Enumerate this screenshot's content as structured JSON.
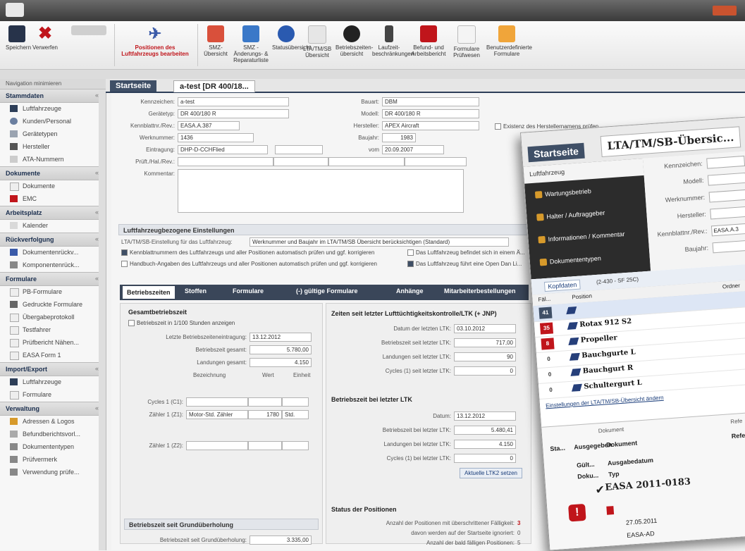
{
  "ribbon": {
    "buttons": [
      {
        "label": "Speichern"
      },
      {
        "label": "Verwerfen"
      },
      {
        "label": "Positionen des Luftfahrzeugs bearbeiten"
      },
      {
        "label": "SMZ-Übersicht"
      },
      {
        "label": "SMZ - Änderungs- & Reparaturliste"
      },
      {
        "label": "Statusübersicht"
      },
      {
        "label": "LTA/TM/SB Übersicht"
      },
      {
        "label": "Betriebszeiten-übersicht"
      },
      {
        "label": "Laufzeit-beschränkungen"
      },
      {
        "label": "Befund- und Arbeitsbericht"
      },
      {
        "label": "Formulare Prüfwesen"
      },
      {
        "label": "Benutzerdefinierte Formulare"
      }
    ]
  },
  "sidebar": {
    "topbar": "Navigation minimieren",
    "groups": [
      {
        "title": "Stammdaten",
        "items": [
          "Luftfahrzeuge",
          "Kunden/Personal",
          "Gerätetypen",
          "Hersteller",
          "ATA-Nummern"
        ]
      },
      {
        "title": "Dokumente",
        "items": [
          "Dokumente",
          "EMC"
        ]
      },
      {
        "title": "Arbeitsplatz",
        "items": [
          "Kalender"
        ]
      },
      {
        "title": "Rückverfolgung",
        "items": [
          "Dokumentenrückv...",
          "Komponentenrück..."
        ]
      },
      {
        "title": "Formulare",
        "items": [
          "PB-Formulare",
          "Gedruckte Formulare",
          "Übergabeprotokoll",
          "Testfahrer",
          "Prüfbericht Nähen...",
          "EASA Form 1"
        ]
      },
      {
        "title": "Import/Export",
        "items": [
          "Luftfahrzeuge",
          "Formulare"
        ]
      },
      {
        "title": "Verwaltung",
        "items": [
          "Adressen & Logos",
          "Befundberichtsvorl...",
          "Dokumententypen",
          "Prüfvermerk",
          "Verwendung prüfe..."
        ]
      }
    ]
  },
  "tabs": {
    "start": "Startseite",
    "current": "a-test [DR 400/18..."
  },
  "form": {
    "kennzeichen_label": "Kennzeichen:",
    "kennzeichen": "a-test",
    "geraetetyp_label": "Gerätetyp:",
    "geraetetyp": "DR 400/180 R",
    "kennblatt_label": "Kennblattnr./Rev.:",
    "kennblatt": "EASA.A.387",
    "werknummer_label": "Werknummer:",
    "werknummer": "1436",
    "eintragung_label": "Eintragung:",
    "eintragung": "DHP-D-CCHFlied",
    "prueft_label": "Prüft./Hal./Rev.:",
    "kommentar_label": "Kommentar:",
    "bauart_label": "Bauart:",
    "bauart": "DBM",
    "modell_label": "Modell:",
    "modell": "DR 400/180 R",
    "hersteller_label": "Hersteller:",
    "hersteller": "APEX Aircraft",
    "baujahr_label": "Baujahr:",
    "baujahr": "1983",
    "vom_label": "vom",
    "vom": "20.09.2007",
    "check_hersteller": "Existenz des Herstellernamens prüfen",
    "settings_title": "Luftfahrzeugbezogene Einstellungen",
    "settings_line": "LTA/TM/SB-Einstellung für das Luftfahrzeug:",
    "settings_value": "Werknummer und Baujahr im LTA/TM/SB Übersicht berücksichtigen (Standard)",
    "chk1": "Kennblattnummern des Luftfahrzeugs und aller Positionen automatisch prüfen und ggf. korrigieren",
    "chk2": "Handbuch-Angaben des Luftfahrzeugs und aller Positionen automatisch prüfen und ggf. korrigieren",
    "chk3": "Das Luftfahrzeug befindet sich in einem Ä...",
    "chk4": "Das Luftfahrzeug führt eine Open Dan Li..."
  },
  "subtabs": [
    "Betriebszeiten",
    "Stoffen",
    "Formulare",
    "(-) gültige Formulare",
    "Anhänge",
    "Mitarbeiterbestellungen"
  ],
  "betrieb": {
    "title": "Gesamtbetriebszeit",
    "chk": "Betriebszeit in 1/100 Stunden anzeigen",
    "l1": "Letzte Betriebszeiteneintragung:",
    "v1": "13.12.2012",
    "l2": "Betriebszeit gesamt:",
    "v2": "5.780,00",
    "l3": "Landungen gesamt:",
    "v3": "4.150",
    "c1": "Bezeichnung",
    "c2": "Wert",
    "c3": "Einheit",
    "z1": "Cycles 1 (C1):",
    "z2": "Zähler 1 (Z1):",
    "z2v": "Motor-Std. Zähler",
    "z2n": "1780",
    "z2u": "Std.",
    "z3": "Zähler 1 (Z2):",
    "grund_title": "Betriebszeit seit Grundüberholung",
    "grund_l": "Betriebszeit seit Grundüberholung:",
    "grund_v": "3.335,00"
  },
  "ltk": {
    "title": "Zeiten seit letzter Lufttüchtigkeitskontrolle/LTK (+ JNP)",
    "l1": "Datum der letzten LTK:",
    "v1": "03.10.2012",
    "l2": "Betriebszeit seit letzter LTK:",
    "v2": "717,00",
    "l3": "Landungen seit letzter LTK:",
    "v3": "90",
    "l4": "Cycles (1) seit letzter LTK:",
    "v4": "0",
    "title2": "Betriebszeit bei letzter LTK",
    "d_l": "Datum:",
    "d_v": "13.12.2012",
    "b_l": "Betriebszeit bei letzter LTK:",
    "b_v": "5.480,41",
    "la_l": "Landungen bei letzter LTK:",
    "la_v": "4.150",
    "c_l": "Cycles (1) bei letzter LTK:",
    "c_v": "0",
    "btn": "Aktuelle LTK2 setzen",
    "status_title": "Status der Positionen",
    "s1": "Anzahl der Positionen mit überschrittener Fälligkeit:",
    "s1v": "3",
    "s2": "davon werden auf der Startseite ignoriert:",
    "s2v": "0",
    "s3": "Anzahl der bald fälligen Positionen:",
    "s3v": "5"
  },
  "overlay": {
    "tab1": "Startseite",
    "tab2": "LTA/TM/SB-Übersic...",
    "navhead": "Luftfahrzeug",
    "nav": [
      "Wartungsbetrieb",
      "Halter / Auftraggeber",
      "Informationen / Kommentar",
      "Dokumententypen"
    ],
    "flabels": [
      "Kennzeichen:",
      "Modell:",
      "Werknummer:",
      "Hersteller:",
      "Kennblattnr./Rev.:",
      "Baujahr:"
    ],
    "fvalues": [
      "",
      "",
      "",
      "",
      "EASA.A.3",
      ""
    ],
    "kopf": "Kopfdaten",
    "kopf2": "(2-430 - SF 25C)",
    "col_pos": "Position",
    "col_ordner": "Ordner",
    "col_fal": "Fäl...",
    "rows": [
      {
        "badge": "41",
        "name": "",
        "color": "#3f4f66"
      },
      {
        "badge": "35",
        "name": "Rotax 912 S2",
        "color": "#c0151b"
      },
      {
        "badge": "8",
        "name": "Propeller",
        "color": "#c0151b"
      },
      {
        "badge": "0",
        "name": "Bauchgurte L",
        "color": "#ffffff"
      },
      {
        "badge": "0",
        "name": "Bauchgurt R",
        "color": "#ffffff"
      },
      {
        "badge": "0",
        "name": "Schultergurt L",
        "color": "#ffffff"
      }
    ],
    "link": "Einstellungen der LTA/TM/SB-Übersicht ändern",
    "docs_head": "Dokument",
    "docs_cols": [
      "Sta...",
      "Ausgegeben",
      "Dokument",
      "Ausgabedatum",
      "Typ"
    ],
    "docs_sub": [
      "Gült...",
      "Doku..."
    ],
    "doc_title": "EASA 2011-0183",
    "doc_date": "27.05.2011",
    "doc_typ": "EASA-AD",
    "right_col": "Refe",
    "right_col2": "Refe Dok"
  }
}
